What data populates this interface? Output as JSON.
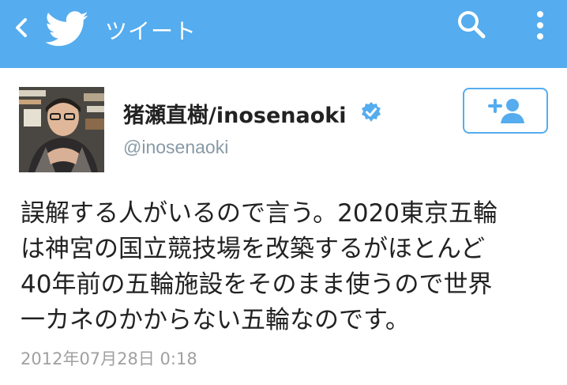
{
  "header": {
    "title": "ツイート",
    "back_icon": "chevron-left-icon",
    "logo_icon": "twitter-bird-icon",
    "search_icon": "search-icon",
    "menu_icon": "more-vertical-icon",
    "bar_color": "#55acee"
  },
  "user": {
    "display_name": "猪瀬直樹/inosenaoki",
    "handle": "@inosenaoki",
    "verified": true,
    "follow_icon": "add-user-icon",
    "accent_color": "#55acee"
  },
  "tweet": {
    "text": "誤解する人がいるので言う。2020東京五輪\nは神宮の国立競技場を改築するがほとんど\n40年前の五輪施設をそのまま使うので世界\n一カネのかからない五輪なのです。",
    "timestamp": "2012年07月28日 0:18"
  }
}
